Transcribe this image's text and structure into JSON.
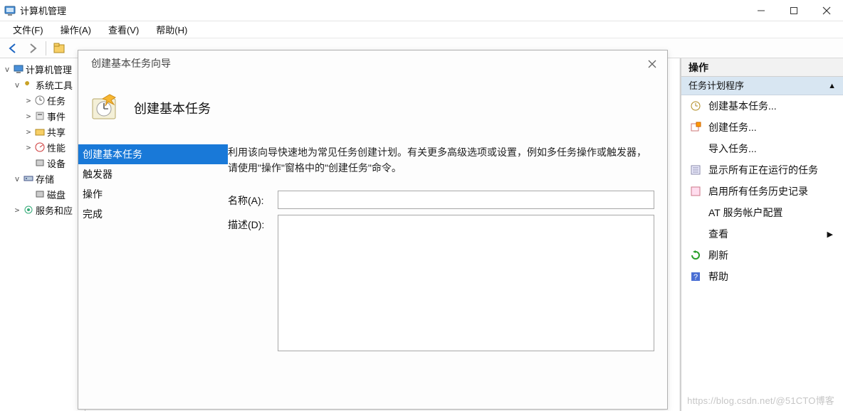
{
  "window": {
    "title": "计算机管理",
    "minimize": "—",
    "maximize": "☐",
    "close": "✕"
  },
  "menubar": {
    "file": "文件(F)",
    "action": "操作(A)",
    "view": "查看(V)",
    "help": "帮助(H)"
  },
  "tree": {
    "root": "计算机管理",
    "sys_tools": "系统工具",
    "task": "任务",
    "event": "事件",
    "share": "共享",
    "perf": "性能",
    "device": "设备",
    "storage": "存储",
    "disk": "磁盘",
    "services": "服务和应"
  },
  "actions": {
    "header": "操作",
    "group_title": "任务计划程序",
    "create_basic": "创建基本任务...",
    "create_task": "创建任务...",
    "import_task": "导入任务...",
    "show_running": "显示所有正在运行的任务",
    "enable_history": "启用所有任务历史记录",
    "at_config": "AT 服务帐户配置",
    "view": "查看",
    "refresh": "刷新",
    "help": "帮助"
  },
  "dialog": {
    "title_small": "创建基本任务向导",
    "hero_title": "创建基本任务",
    "steps": {
      "create": "创建基本任务",
      "trigger": "触发器",
      "action": "操作",
      "finish": "完成"
    },
    "desc": "利用该向导快速地为常见任务创建计划。有关更多高级选项或设置，例如多任务操作或触发器，请使用\"操作\"窗格中的\"创建任务\"命令。",
    "name_label": "名称(A):",
    "name_value": "",
    "desc_label": "描述(D):",
    "desc_value": ""
  },
  "watermark": "https://blog.csdn.net/@51CTO博客"
}
